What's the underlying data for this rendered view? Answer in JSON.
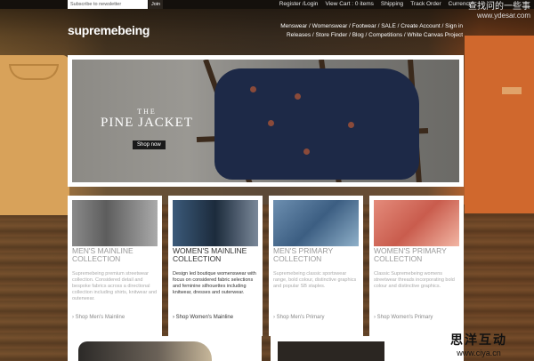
{
  "topbar": {
    "newsletter_placeholder": "Subscribe to newsletter",
    "join_label": "Join",
    "links": [
      "Register /Login",
      "View Cart : 0 items",
      "Shipping",
      "Track Order",
      "Currency"
    ]
  },
  "watermark": {
    "text": "查找问的一些事",
    "url": "www.ydesar.com"
  },
  "logo": "supremebeing",
  "nav": {
    "row1": [
      "Menswear",
      "Womenswear",
      "Footwear",
      "SALE",
      "Create Account",
      "Sign in"
    ],
    "row2": [
      "Releases",
      "Store Finder",
      "Blog",
      "Competitions",
      "White Canvas Project"
    ]
  },
  "hero": {
    "the": "THE",
    "title": "PINE JACKET",
    "cta": "Shop now"
  },
  "cards": [
    {
      "title": "MEN'S MAINLINE COLLECTION",
      "desc": "Supremebeing premium streetwear collection. Considered detail and bespoke fabrics across a directional collection including shirts, knitwear and outerwear.",
      "shop": "Shop Men's Mainline"
    },
    {
      "title": "WOMEN'S MAINLINE COLLECTION",
      "desc": "Design led boutique womenswear with focus on considered fabric selections and feminine silhouettes including knitwear, dresses and outerwear.",
      "shop": "Shop Women's Mainline"
    },
    {
      "title": "MEN'S PRIMARY COLLECTION",
      "desc": "Supremebeing classic sportswear range, bold colour, distinctive graphics and popular SB staples.",
      "shop": "Shop Men's Primary"
    },
    {
      "title": "WOMEN'S PRIMARY COLLECTION",
      "desc": "Classic Supremebeing womens streetwear threads incorporating bold colour and distinctive graphics.",
      "shop": "Shop Women's Primary"
    }
  ],
  "footer_watermark": {
    "text": "思洋互动",
    "url": "www.ciya.cn"
  },
  "colors": {
    "hero_bg": "#ffffff",
    "jacket": "#1d2947",
    "accent_orange": "#d0682d"
  }
}
